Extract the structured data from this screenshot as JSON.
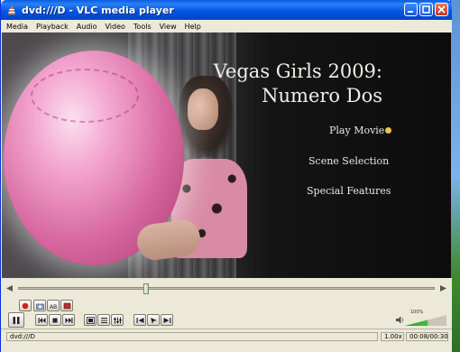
{
  "window": {
    "title": "dvd:///D - VLC media player"
  },
  "menu": [
    "Media",
    "Playback",
    "Audio",
    "Video",
    "Tools",
    "View",
    "Help"
  ],
  "dvd_menu": {
    "title_line1": "Vegas Girls 2009:",
    "title_line2": "Numero Dos",
    "items": [
      "Play Movie",
      "Scene Selection",
      "Special Features"
    ]
  },
  "volume": {
    "label": "100%",
    "level": 0.55
  },
  "status": {
    "source": "dvd:///D",
    "speed": "1.00x",
    "time": "00:08/00:30"
  },
  "colors": {
    "titlebar": "#0054e3",
    "bullet": "#e8c44a",
    "record": "#d62020"
  }
}
